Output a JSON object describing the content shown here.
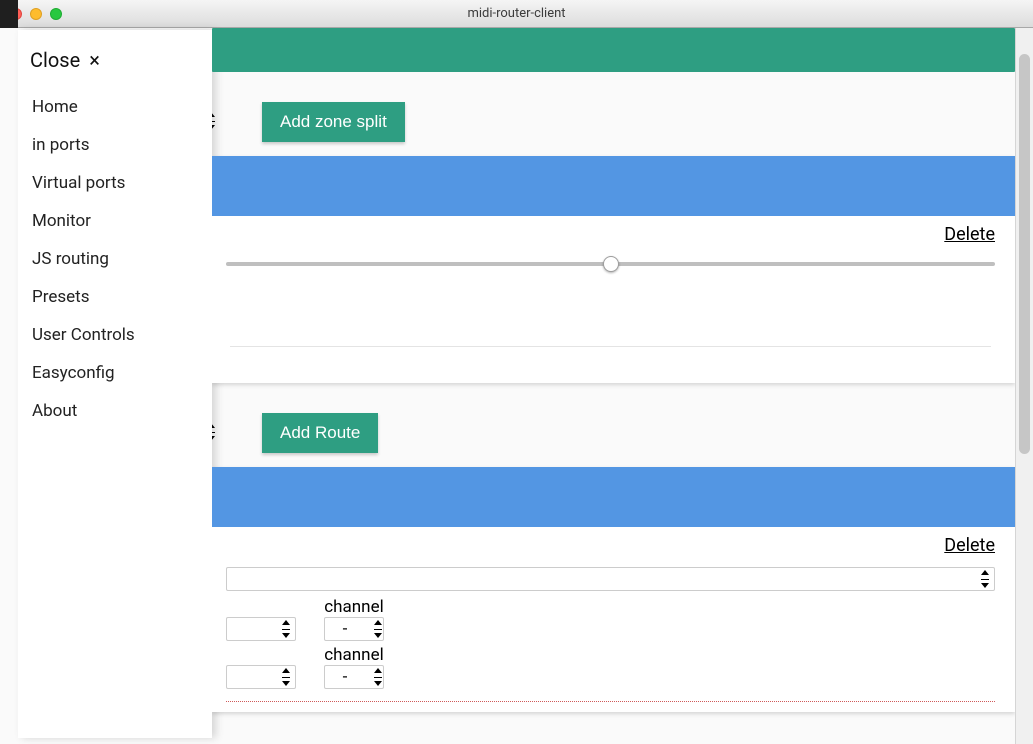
{
  "window": {
    "title": "midi-router-client"
  },
  "sidebar": {
    "close_label": "Close",
    "items": [
      {
        "label": "Home"
      },
      {
        "label": "in ports"
      },
      {
        "label": "Virtual ports"
      },
      {
        "label": "Monitor"
      },
      {
        "label": "JS routing"
      },
      {
        "label": "Presets"
      },
      {
        "label": "User Controls"
      },
      {
        "label": "Easyconfig"
      },
      {
        "label": "About"
      }
    ]
  },
  "main": {
    "add_zone_split_label": "Add zone split",
    "add_route_label": "Add Route",
    "delete_label": "Delete",
    "slider": {
      "value": 50
    },
    "channel_label": "channel",
    "channel_value": "-"
  }
}
